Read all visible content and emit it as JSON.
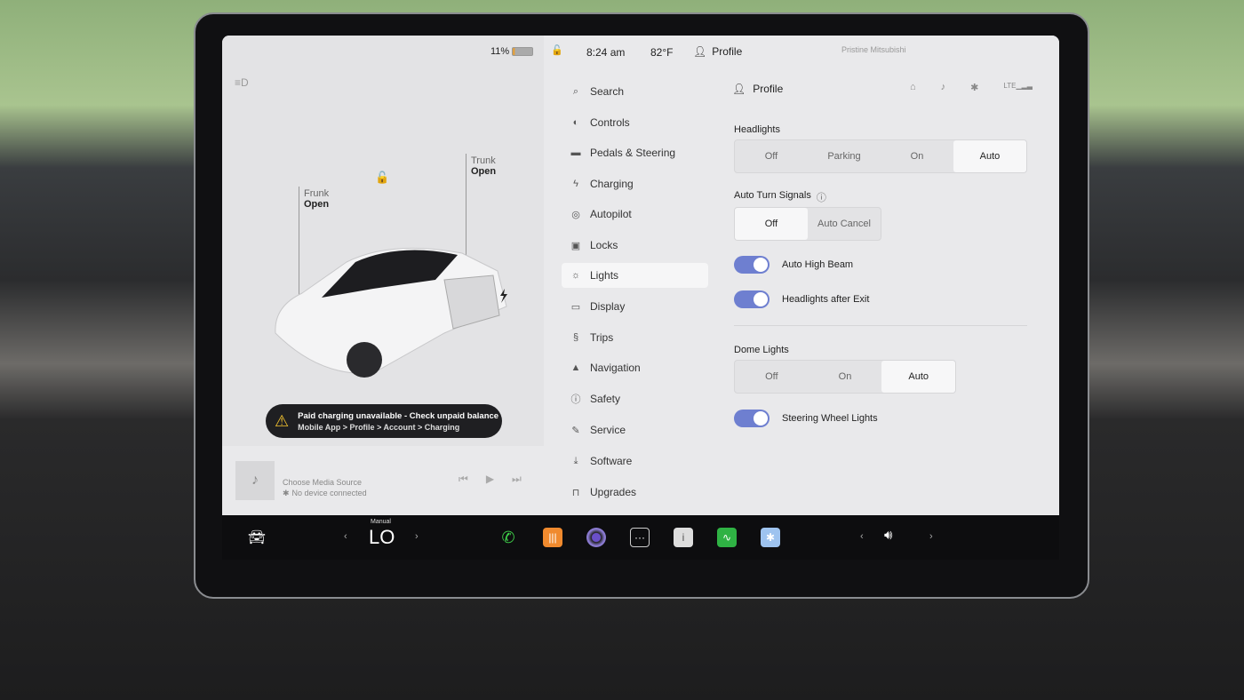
{
  "status": {
    "battery": "11%",
    "time": "8:24 am",
    "temp": "82°F",
    "profile": "Profile",
    "network_name": "Pristine Mitsubishi"
  },
  "car": {
    "frunk_label": "Frunk",
    "frunk_state": "Open",
    "trunk_label": "Trunk",
    "trunk_state": "Open"
  },
  "alert": {
    "title": "Paid charging unavailable - Check unpaid balance",
    "subtitle": "Mobile App > Profile > Account > Charging"
  },
  "media": {
    "source": "Choose Media Source",
    "device": "No device connected"
  },
  "nav": [
    {
      "label": "Search",
      "icon": "search-icon"
    },
    {
      "label": "Controls",
      "icon": "toggle-icon"
    },
    {
      "label": "Pedals & Steering",
      "icon": "car-icon"
    },
    {
      "label": "Charging",
      "icon": "bolt-icon"
    },
    {
      "label": "Autopilot",
      "icon": "steering-wheel-icon"
    },
    {
      "label": "Locks",
      "icon": "lock-icon"
    },
    {
      "label": "Lights",
      "icon": "bulb-icon",
      "active": true
    },
    {
      "label": "Display",
      "icon": "display-icon"
    },
    {
      "label": "Trips",
      "icon": "trips-icon"
    },
    {
      "label": "Navigation",
      "icon": "navigation-icon"
    },
    {
      "label": "Safety",
      "icon": "safety-icon"
    },
    {
      "label": "Service",
      "icon": "wrench-icon"
    },
    {
      "label": "Software",
      "icon": "download-icon"
    },
    {
      "label": "Upgrades",
      "icon": "bag-icon"
    }
  ],
  "settings": {
    "profile": "Profile",
    "headlights": {
      "label": "Headlights",
      "options": [
        "Off",
        "Parking",
        "On",
        "Auto"
      ],
      "selected": "Auto"
    },
    "turn_signals": {
      "label": "Auto Turn Signals",
      "options": [
        "Off",
        "Auto Cancel"
      ],
      "selected": "Off"
    },
    "auto_high_beam": {
      "label": "Auto High Beam",
      "on": true
    },
    "headlights_after_exit": {
      "label": "Headlights after Exit",
      "on": true
    },
    "dome": {
      "label": "Dome Lights",
      "options": [
        "Off",
        "On",
        "Auto"
      ],
      "selected": "Auto"
    },
    "steering_lights": {
      "label": "Steering Wheel Lights",
      "on": true
    }
  },
  "taskbar": {
    "climate_mode": "Manual",
    "climate_temp": "LO"
  },
  "colors": {
    "toggle_on": "#6e7fd0",
    "alert_bg": "#1f1f22",
    "alert_icon": "#f2c230"
  }
}
